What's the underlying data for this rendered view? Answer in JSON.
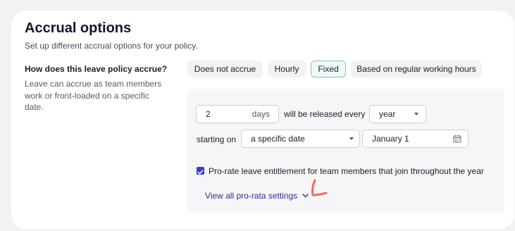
{
  "header": {
    "title": "Accrual options",
    "subtitle": "Set up different accrual options for your policy."
  },
  "question": {
    "label": "How does this leave policy accrue?",
    "help": "Leave can accrue as team members work or front-loaded on a specific date."
  },
  "accrual_types": {
    "selected": "Fixed",
    "options": [
      "Does not accrue",
      "Hourly",
      "Fixed",
      "Based on regular working hours"
    ]
  },
  "fixed": {
    "amount_value": "2",
    "amount_unit": "days",
    "released_text": "will be released every",
    "period_value": "year",
    "starting_text": "starting on",
    "start_mode_value": "a specific date",
    "date_value": "January 1"
  },
  "prorate": {
    "checked": true,
    "label": "Pro-rate leave entitlement for team members that join throughout the year",
    "link": "View all pro-rata settings"
  },
  "colors": {
    "accent": "#3a3ad6",
    "selected_border": "#7ec7b7",
    "annotation": "#f26b5b"
  }
}
